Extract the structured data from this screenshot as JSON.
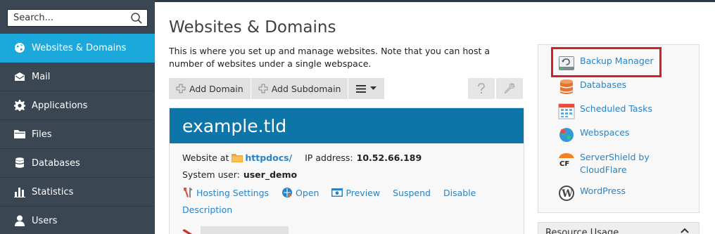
{
  "sidebar": {
    "search_placeholder": "Search...",
    "items": [
      {
        "label": "Websites & Domains",
        "icon": "globe-icon",
        "active": true
      },
      {
        "label": "Mail",
        "icon": "mail-icon"
      },
      {
        "label": "Applications",
        "icon": "gear-icon"
      },
      {
        "label": "Files",
        "icon": "folder-icon"
      },
      {
        "label": "Databases",
        "icon": "database-icon"
      },
      {
        "label": "Statistics",
        "icon": "bar-chart-icon"
      },
      {
        "label": "Users",
        "icon": "user-icon"
      }
    ]
  },
  "main": {
    "title": "Websites & Domains",
    "description": "This is where you set up and manage websites. Note that you can host a number of websites under a single webspace.",
    "toolbar": {
      "add_domain": "Add Domain",
      "add_subdomain": "Add Subdomain"
    }
  },
  "domain": {
    "name": "example.tld",
    "website_at_label": "Website at",
    "website_folder": "httpdocs/",
    "ip_label": "IP address:",
    "ip_value": "10.52.66.189",
    "system_user_label": "System user:",
    "system_user_value": "user_demo",
    "actions": {
      "hosting_settings": "Hosting Settings",
      "open": "Open",
      "preview": "Preview",
      "suspend": "Suspend",
      "disable": "Disable",
      "description": "Description"
    }
  },
  "right_panel": {
    "items": [
      {
        "label": "Backup Manager",
        "icon": "backup-icon"
      },
      {
        "label": "Databases",
        "icon": "database-icon"
      },
      {
        "label": "Scheduled Tasks",
        "icon": "calendar-icon"
      },
      {
        "label": "Webspaces",
        "icon": "webspaces-icon"
      },
      {
        "label": "ServerShield by CloudFlare",
        "icon": "cloudflare-icon"
      },
      {
        "label": "WordPress",
        "icon": "wordpress-icon"
      }
    ],
    "resource_usage_title": "Resource Usage"
  },
  "colors": {
    "sidebar_bg": "#3a4651",
    "active_item": "#1ba9dc",
    "domain_header": "#0e75a9",
    "link": "#2a83c6",
    "highlight": "#d62027"
  }
}
